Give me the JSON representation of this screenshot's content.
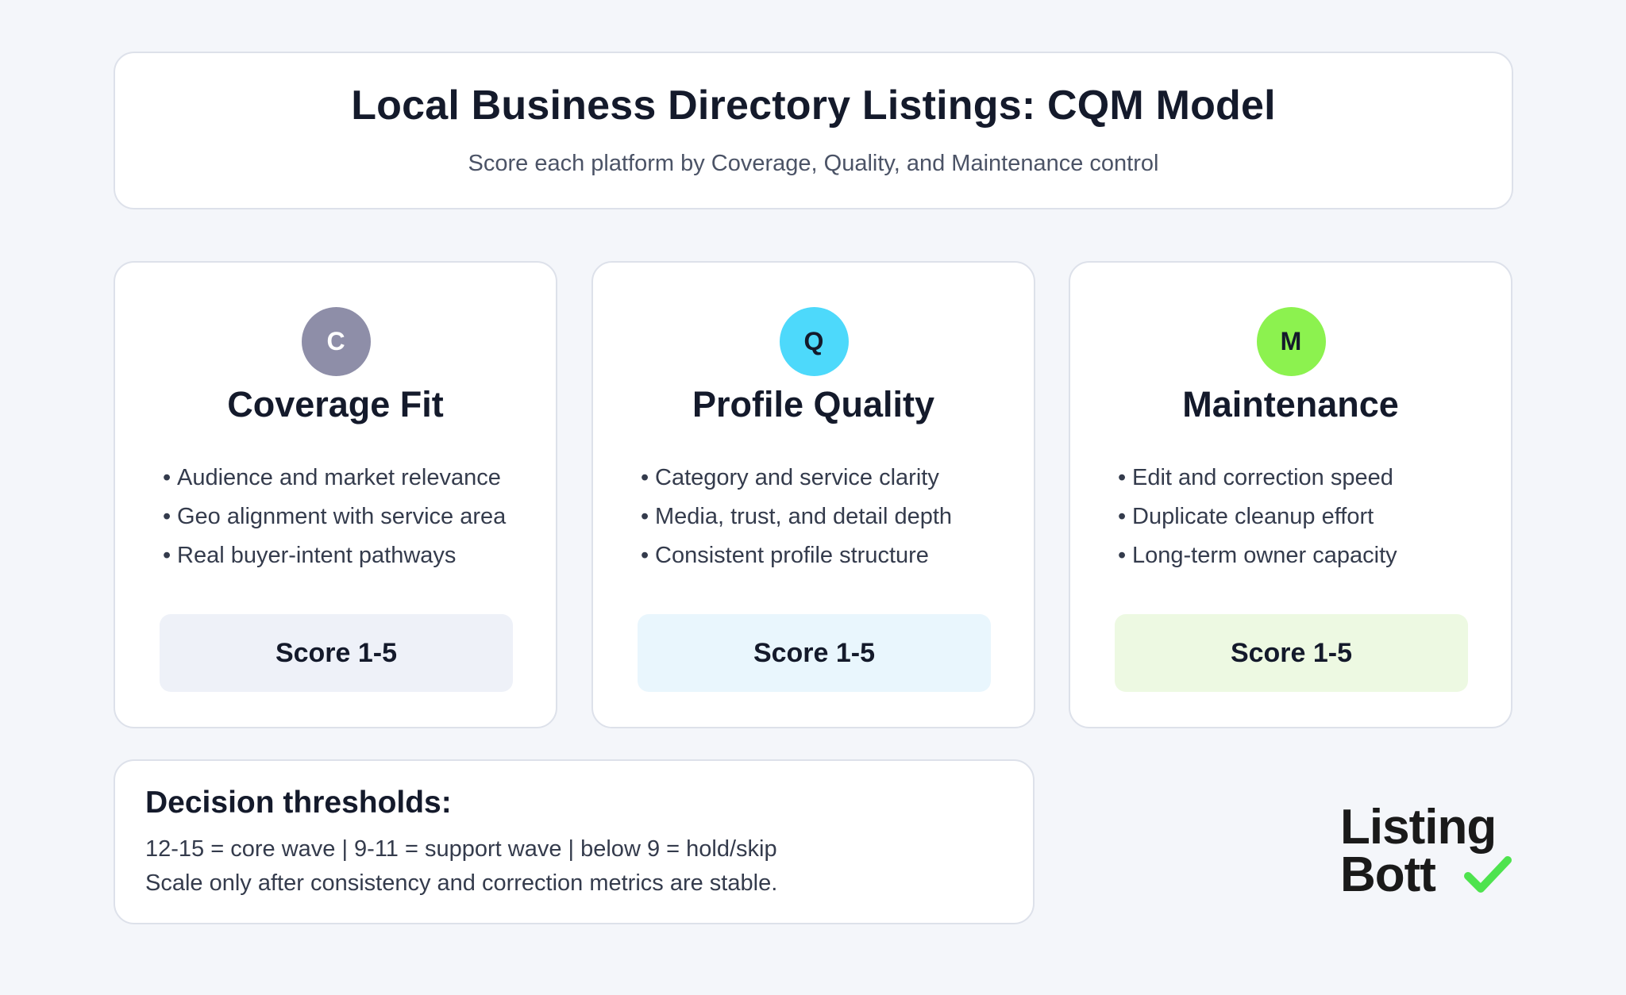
{
  "header": {
    "title": "Local Business Directory Listings: CQM Model",
    "subtitle": "Score each platform by Coverage, Quality, and Maintenance control"
  },
  "factors": [
    {
      "letter": "C",
      "name": "Coverage Fit",
      "color": "#8e8ea8",
      "score_bg": "#eef1f8",
      "bullets": [
        "Audience and market relevance",
        "Geo alignment with service area",
        "Real buyer-intent pathways"
      ],
      "score_label": "Score 1-5"
    },
    {
      "letter": "Q",
      "name": "Profile Quality",
      "color": "#4dd9fb",
      "score_bg": "#e9f6fd",
      "bullets": [
        "Category and service clarity",
        "Media, trust, and detail depth",
        "Consistent profile structure"
      ],
      "score_label": "Score 1-5"
    },
    {
      "letter": "M",
      "name": "Maintenance",
      "color": "#8cf24f",
      "score_bg": "#edf9e2",
      "bullets": [
        "Edit and correction speed",
        "Duplicate cleanup effort",
        "Long-term owner capacity"
      ],
      "score_label": "Score 1-5"
    }
  ],
  "thresholds": {
    "title": "Decision thresholds:",
    "line1": "12-15 = core wave | 9-11 = support wave | below 9 = hold/skip",
    "line2": "Scale only after consistency and correction metrics are stable."
  },
  "logo": {
    "line1": "Listing",
    "line2": "Bott",
    "icon": "checkmark-icon",
    "accent": "#4ee34e"
  }
}
